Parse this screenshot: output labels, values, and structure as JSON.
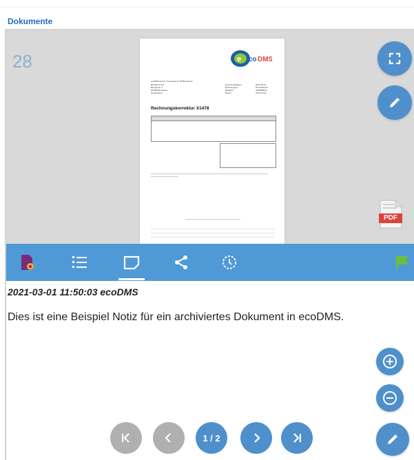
{
  "header": {
    "title": "Dokumente"
  },
  "preview": {
    "page_count": "28",
    "document": {
      "logo_text": "ecoDMS",
      "sender_line": "ecoDMS GmbH | Kreuzweg 9 | 52066 Aachen",
      "recipient": [
        "Beispiel Firma",
        "Beispielstr. 1",
        "99 999 Beispielort",
        "Deutschland"
      ],
      "meta_labels": [
        "Rechnungsdatum:",
        "Rechnungsnr.:",
        "Bestellnr.:",
        "Datum:"
      ],
      "meta_values": [
        "2021-04-14",
        "RTX1001123",
        "4445688214",
        "2021-03-18"
      ],
      "heading": "Rechnungskorrektur X1478"
    }
  },
  "fabs": {
    "fullscreen": "fullscreen-icon",
    "edit": "pencil-icon",
    "zoom_in": "zoom-in-icon",
    "zoom_out": "zoom-out-icon",
    "edit_bottom": "pencil-icon"
  },
  "badge": {
    "pdf_label": "PDF"
  },
  "toolbar": {
    "items": [
      "document-settings-icon",
      "list-icon",
      "notes-icon",
      "share-icon",
      "history-icon",
      "flag-icon"
    ],
    "active": "notes-icon"
  },
  "note": {
    "meta": "2021-03-01 11:50:03 ecoDMS",
    "text": "Dies ist eine Beispiel Notiz für ein archiviertes Dokument in ecoDMS."
  },
  "pager": {
    "label": "1 / 2"
  },
  "colors": {
    "accent": "#4f90cc",
    "toolbar": "#4f9ad6",
    "title": "#1c6fb8",
    "flag": "#6bbf3a",
    "pdf": "#d9433b"
  }
}
